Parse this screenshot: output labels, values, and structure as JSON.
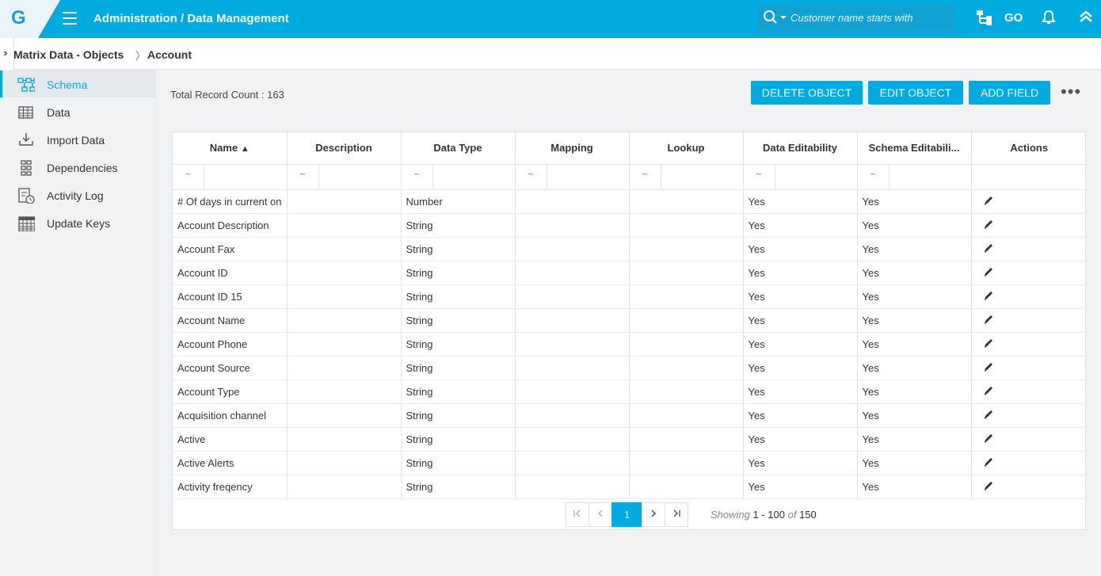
{
  "header": {
    "logo_letter": "G",
    "title": "Administration / Data Management",
    "search_placeholder": "Customer name starts with",
    "icons": [
      "search-icon",
      "org-chart-icon",
      "go-icon",
      "bell-icon",
      "chevron-up-icon"
    ],
    "go_label": "GO"
  },
  "breadcrumb": {
    "parent": "Matrix Data - Objects",
    "current": "Account"
  },
  "sidebar": {
    "items": [
      {
        "label": "Schema",
        "icon": "schema-icon",
        "active": true
      },
      {
        "label": "Data",
        "icon": "grid-icon"
      },
      {
        "label": "Import Data",
        "icon": "download-icon"
      },
      {
        "label": "Dependencies",
        "icon": "dependencies-icon"
      },
      {
        "label": "Activity Log",
        "icon": "activity-log-icon"
      },
      {
        "label": "Update Keys",
        "icon": "calendar-grid-icon"
      }
    ]
  },
  "main": {
    "record_count": "Total Record Count : 163",
    "buttons": {
      "delete": "DELETE OBJECT",
      "edit": "EDIT OBJECT",
      "add": "ADD FIELD"
    },
    "more": "•••"
  },
  "table": {
    "columns": [
      "Name",
      "Description",
      "Data Type",
      "Mapping",
      "Lookup",
      "Data Editability",
      "Schema Editabili...",
      "Actions"
    ],
    "sort_indicator": "▲",
    "filter_op": "~",
    "rows": [
      {
        "name": "# Of days in current on",
        "description": "",
        "type": "Number",
        "mapping": "",
        "lookup": "",
        "data_edit": "Yes",
        "schema_edit": "Yes"
      },
      {
        "name": "Account Description",
        "description": "",
        "type": "String",
        "mapping": "",
        "lookup": "",
        "data_edit": "Yes",
        "schema_edit": "Yes"
      },
      {
        "name": "Account Fax",
        "description": "",
        "type": "String",
        "mapping": "",
        "lookup": "",
        "data_edit": "Yes",
        "schema_edit": "Yes"
      },
      {
        "name": "Account ID",
        "description": "",
        "type": "String",
        "mapping": "",
        "lookup": "",
        "data_edit": "Yes",
        "schema_edit": "Yes"
      },
      {
        "name": "Account ID 15",
        "description": "",
        "type": "String",
        "mapping": "",
        "lookup": "",
        "data_edit": "Yes",
        "schema_edit": "Yes"
      },
      {
        "name": "Account Name",
        "description": "",
        "type": "String",
        "mapping": "",
        "lookup": "",
        "data_edit": "Yes",
        "schema_edit": "Yes"
      },
      {
        "name": "Account Phone",
        "description": "",
        "type": "String",
        "mapping": "",
        "lookup": "",
        "data_edit": "Yes",
        "schema_edit": "Yes"
      },
      {
        "name": "Account Source",
        "description": "",
        "type": "String",
        "mapping": "",
        "lookup": "",
        "data_edit": "Yes",
        "schema_edit": "Yes"
      },
      {
        "name": "Account Type",
        "description": "",
        "type": "String",
        "mapping": "",
        "lookup": "",
        "data_edit": "Yes",
        "schema_edit": "Yes"
      },
      {
        "name": "Acquisition channel",
        "description": "",
        "type": "String",
        "mapping": "",
        "lookup": "",
        "data_edit": "Yes",
        "schema_edit": "Yes"
      },
      {
        "name": "Active",
        "description": "",
        "type": "String",
        "mapping": "",
        "lookup": "",
        "data_edit": "Yes",
        "schema_edit": "Yes"
      },
      {
        "name": "Active Alerts",
        "description": "",
        "type": "String",
        "mapping": "",
        "lookup": "",
        "data_edit": "Yes",
        "schema_edit": "Yes"
      },
      {
        "name": "Activity freqency",
        "description": "",
        "type": "String",
        "mapping": "",
        "lookup": "",
        "data_edit": "Yes",
        "schema_edit": "Yes"
      }
    ]
  },
  "pagination": {
    "current_page": "1",
    "first": "⟨|",
    "showing_label": "Showing",
    "range": "1 - 100",
    "of_label": "of",
    "total": "150"
  },
  "colors": {
    "accent": "#00abe1",
    "header_bg": "#00abe1",
    "sidebar_bg": "#f0f2f4"
  }
}
